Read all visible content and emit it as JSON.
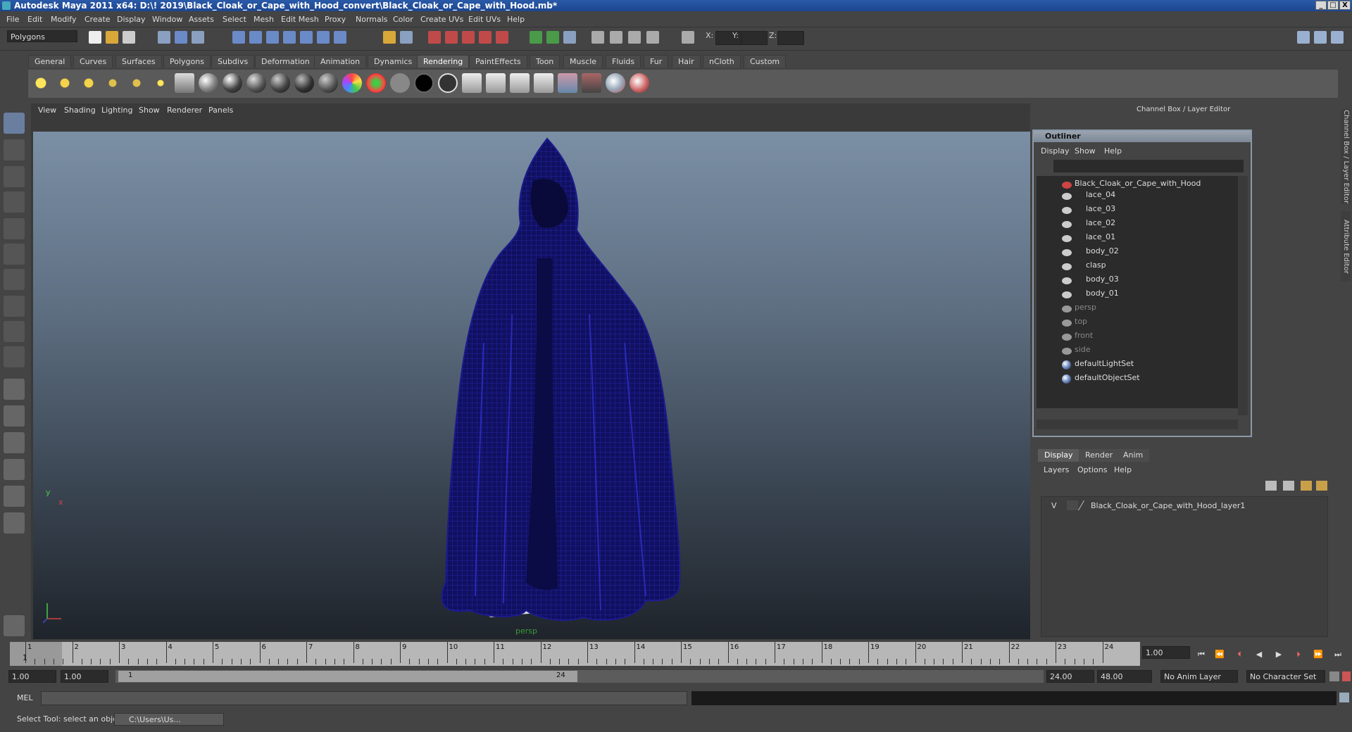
{
  "window": {
    "title": "Autodesk Maya 2011 x64: D:\\! 2019\\Black_Cloak_or_Cape_with_Hood_convert\\Black_Cloak_or_Cape_with_Hood.mb*",
    "minimize": "_",
    "maximize": "□",
    "close": "X"
  },
  "menubar": [
    "File",
    "Edit",
    "Modify",
    "Create",
    "Display",
    "Window",
    "Assets",
    "Select",
    "Mesh",
    "Edit Mesh",
    "Proxy",
    "Normals",
    "Color",
    "Create UVs",
    "Edit UVs",
    "Help"
  ],
  "statusline": {
    "mode": "Polygons",
    "x_label": "X:",
    "y_label": "Y:",
    "z_label": "Z:"
  },
  "shelf_tabs": [
    "General",
    "Curves",
    "Surfaces",
    "Polygons",
    "Subdivs",
    "Deformation",
    "Animation",
    "Dynamics",
    "Rendering",
    "PaintEffects",
    "Toon",
    "Muscle",
    "Fluids",
    "Fur",
    "Hair",
    "nCloth",
    "Custom"
  ],
  "shelf_active_tab": "Rendering",
  "viewport": {
    "menu": [
      "View",
      "Shading",
      "Lighting",
      "Show",
      "Renderer",
      "Panels"
    ],
    "camera_label": "persp",
    "axis_y": "y",
    "axis_x": "x",
    "wire_color": "#1a1a8c"
  },
  "channel_box": {
    "title": "Channel Box / Layer Editor",
    "side_tabs": [
      "Channel Box / Layer Editor",
      "Attribute Editor"
    ]
  },
  "outliner": {
    "title": "Outliner",
    "menu": [
      "Display",
      "Show",
      "Help"
    ],
    "root": "Black_Cloak_or_Cape_with_Hood",
    "children": [
      "lace_04",
      "lace_03",
      "lace_02",
      "lace_01",
      "body_02",
      "clasp",
      "body_03",
      "body_01"
    ],
    "cameras": [
      "persp",
      "top",
      "front",
      "side"
    ],
    "sets": [
      "defaultLightSet",
      "defaultObjectSet"
    ]
  },
  "layer_editor": {
    "tabs": [
      "Display",
      "Render",
      "Anim"
    ],
    "active_tab": "Display",
    "menu": [
      "Layers",
      "Options",
      "Help"
    ],
    "layer_visible": "V",
    "layer_name": "Black_Cloak_or_Cape_with_Hood_layer1"
  },
  "timeline": {
    "ticks": [
      "1",
      "2",
      "3",
      "4",
      "5",
      "6",
      "7",
      "8",
      "9",
      "10",
      "11",
      "12",
      "13",
      "14",
      "15",
      "16",
      "17",
      "18",
      "19",
      "20",
      "21",
      "22",
      "23",
      "24"
    ],
    "current_frame": "1",
    "current_time_field": "1.00"
  },
  "range": {
    "start_time": "1.00",
    "playback_start": "1.00",
    "range_start": "1",
    "range_end": "24",
    "playback_end": "24.00",
    "end_time": "48.00",
    "anim_layer": "No Anim Layer",
    "character_set": "No Character Set"
  },
  "command_line": {
    "label": "MEL"
  },
  "help_line": {
    "text": "Select Tool: select an object",
    "taskbar_item": "C:\\Users\\Us..."
  }
}
